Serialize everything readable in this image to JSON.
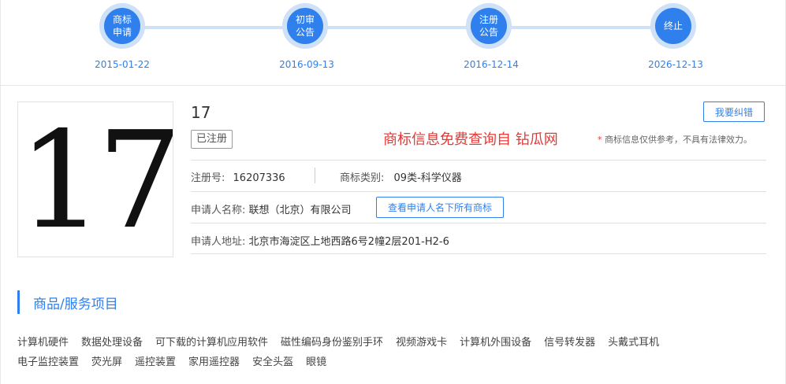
{
  "timeline": [
    {
      "label": "商标\n申请",
      "line1": "商标",
      "line2": "申请",
      "date": "2015-01-22"
    },
    {
      "label": "初审\n公告",
      "line1": "初审",
      "line2": "公告",
      "date": "2016-09-13"
    },
    {
      "label": "注册\n公告",
      "line1": "注册",
      "line2": "公告",
      "date": "2016-12-14"
    },
    {
      "label": "终止",
      "line1": "终止",
      "line2": "",
      "date": "2026-12-13"
    }
  ],
  "trademark": {
    "image_text": "17",
    "name": "17",
    "status": "已注册",
    "correct_button": "我要纠错",
    "promo": "商标信息免费查询自 钻瓜网",
    "disclaimer_star": "*",
    "disclaimer": "商标信息仅供参考，不具有法律效力。",
    "reg_no_label": "注册号:",
    "reg_no": "16207336",
    "class_label": "商标类别:",
    "class_value": "09类-科学仪器",
    "applicant_label": "申请人名称:",
    "applicant": "联想（北京）有限公司",
    "all_button": "查看申请人名下所有商标",
    "address_label": "申请人地址:",
    "address": "北京市海淀区上地西路6号2幢2层201-H2-6"
  },
  "goods": {
    "title": "商品/服务项目",
    "row1": [
      "计算机硬件",
      "数据处理设备",
      "可下载的计算机应用软件",
      "磁性编码身份鉴别手环",
      "视频游戏卡",
      "计算机外围设备",
      "信号转发器",
      "头戴式耳机"
    ],
    "row2": [
      "电子监控装置",
      "荧光屏",
      "遥控装置",
      "家用遥控器",
      "安全头盔",
      "眼镜"
    ]
  }
}
